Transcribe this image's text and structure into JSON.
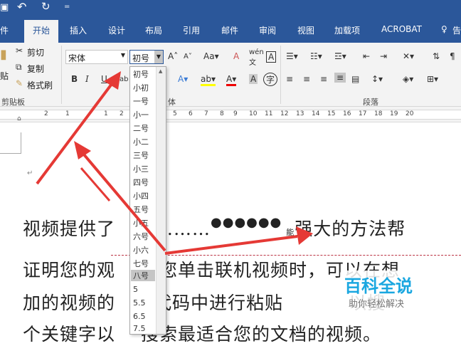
{
  "titlebar": {
    "undo": "↶",
    "redo": "↻",
    "more": "="
  },
  "tabs": [
    "件",
    "开始",
    "插入",
    "设计",
    "布局",
    "引用",
    "邮件",
    "审阅",
    "视图",
    "加载项",
    "ACROBAT",
    "告"
  ],
  "clipboard": {
    "cut": "剪切",
    "copy": "复制",
    "paste_fmt": "格式刷",
    "paste": "贴",
    "group": "剪贴板"
  },
  "font": {
    "name": "宋体",
    "size": "初号",
    "group": "体"
  },
  "paragraph": {
    "group": "段落"
  },
  "font_sizes": [
    "初号",
    "小初",
    "一号",
    "小一",
    "二号",
    "小二",
    "三号",
    "小三",
    "四号",
    "小四",
    "五号",
    "小五",
    "六号",
    "小六",
    "七号",
    "八号",
    "5",
    "5.5",
    "6.5",
    "7.5"
  ],
  "highlighted_size": "八号",
  "ruler": [
    "2",
    "1",
    "1",
    "2",
    "3",
    "4",
    "5",
    "6",
    "7",
    "8",
    "9",
    "10",
    "11",
    "12",
    "13",
    "14",
    "15",
    "16",
    "17",
    "18",
    "19",
    "20"
  ],
  "doc": {
    "line1_a": "视频",
    "line1_b": "提供了",
    "line1_c": "………",
    "line1_d": "●●●●●●",
    "line1_e": "能",
    "line1_f": "强大的方法帮",
    "line2": "证明您的观",
    "line2_b": "当您单击联机视频时，可以在想",
    "line3": "加的视频",
    "line3_b": "的",
    "line3_c": "入代码",
    "line3_d": "中进行粘贴",
    "line3_e": "以搜",
    "line4": "个关键字以",
    "line4_b": "搜索最适合您的文档的视频。"
  },
  "watermark": {
    "title": "百科全说",
    "subtitle": "助你轻松解决"
  },
  "colors": {
    "ribbon_blue": "#2b579a",
    "arrow": "#e53935",
    "brand_blue": "#1aa7e0"
  }
}
